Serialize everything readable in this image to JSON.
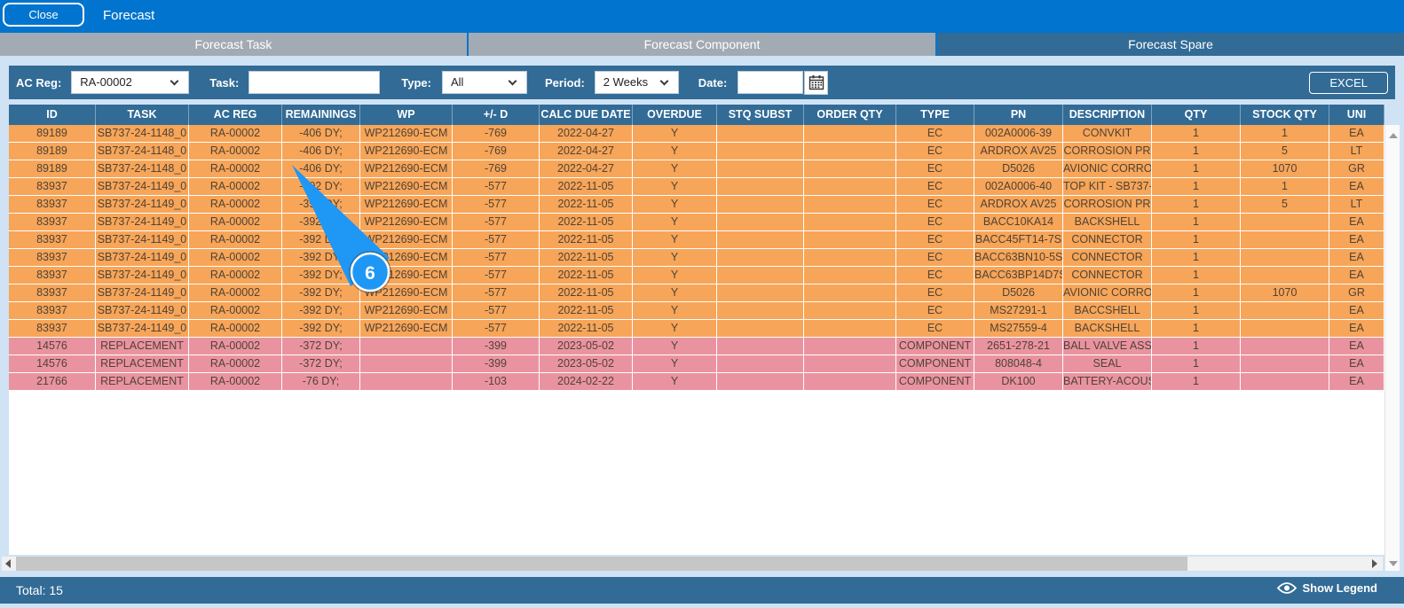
{
  "header": {
    "title": "Forecast",
    "close_label": "Close"
  },
  "tabs": [
    {
      "label": "Forecast Task",
      "active": false
    },
    {
      "label": "Forecast Component",
      "active": false
    },
    {
      "label": "Forecast Spare",
      "active": true
    }
  ],
  "filters": {
    "ac_reg_label": "AC Reg:",
    "ac_reg_value": "RA-00002",
    "task_label": "Task:",
    "task_value": "",
    "type_label": "Type:",
    "type_value": "All",
    "period_label": "Period:",
    "period_value": "2 Weeks",
    "date_label": "Date:",
    "date_value": "",
    "excel_label": "EXCEL",
    "calendar_icon": "calendar-icon"
  },
  "table": {
    "columns": [
      {
        "label": "ID"
      },
      {
        "label": "TASK"
      },
      {
        "label": "AC REG"
      },
      {
        "label": "REMAININGS"
      },
      {
        "label": "WP"
      },
      {
        "label": "+/- D"
      },
      {
        "label": "CALC DUE DATE"
      },
      {
        "label": "OVERDUE"
      },
      {
        "label": "STQ SUBST"
      },
      {
        "label": "ORDER QTY"
      },
      {
        "label": "TYPE"
      },
      {
        "label": "PN"
      },
      {
        "label": "DESCRIPTION"
      },
      {
        "label": "QTY"
      },
      {
        "label": "STOCK QTY"
      },
      {
        "label": "UNI"
      }
    ],
    "rows": [
      {
        "tone": "orange",
        "cells": [
          "89189",
          "SB737-24-1148_0",
          "RA-00002",
          "-406 DY;",
          "WP212690-ECM",
          "-769",
          "2022-04-27",
          "Y",
          "",
          "",
          "EC",
          "002A0006-39",
          "CONVKIT",
          "1",
          "1",
          "EA"
        ]
      },
      {
        "tone": "orange",
        "cells": [
          "89189",
          "SB737-24-1148_0",
          "RA-00002",
          "-406 DY;",
          "WP212690-ECM",
          "-769",
          "2022-04-27",
          "Y",
          "",
          "",
          "EC",
          "ARDROX AV25",
          "CORROSION PR",
          "1",
          "5",
          "LT"
        ]
      },
      {
        "tone": "orange",
        "cells": [
          "89189",
          "SB737-24-1148_0",
          "RA-00002",
          "-406 DY;",
          "WP212690-ECM",
          "-769",
          "2022-04-27",
          "Y",
          "",
          "",
          "EC",
          "D5026",
          "AVIONIC CORRO",
          "1",
          "1070",
          "GR"
        ]
      },
      {
        "tone": "orange",
        "cells": [
          "83937",
          "SB737-24-1149_0",
          "RA-00002",
          "-392 DY;",
          "WP212690-ECM",
          "-577",
          "2022-11-05",
          "Y",
          "",
          "",
          "EC",
          "002A0006-40",
          "TOP KIT - SB737-",
          "1",
          "1",
          "EA"
        ]
      },
      {
        "tone": "orange",
        "cells": [
          "83937",
          "SB737-24-1149_0",
          "RA-00002",
          "-392 DY;",
          "WP212690-ECM",
          "-577",
          "2022-11-05",
          "Y",
          "",
          "",
          "EC",
          "ARDROX AV25",
          "CORROSION PR",
          "1",
          "5",
          "LT"
        ]
      },
      {
        "tone": "orange",
        "cells": [
          "83937",
          "SB737-24-1149_0",
          "RA-00002",
          "-392 DY;",
          "WP212690-ECM",
          "-577",
          "2022-11-05",
          "Y",
          "",
          "",
          "EC",
          "BACC10KA14",
          "BACKSHELL",
          "1",
          "",
          "EA"
        ]
      },
      {
        "tone": "orange",
        "cells": [
          "83937",
          "SB737-24-1149_0",
          "RA-00002",
          "-392 DY;",
          "WP212690-ECM",
          "-577",
          "2022-11-05",
          "Y",
          "",
          "",
          "EC",
          "BACC45FT14-7S",
          "CONNECTOR",
          "1",
          "",
          "EA"
        ]
      },
      {
        "tone": "orange",
        "cells": [
          "83937",
          "SB737-24-1149_0",
          "RA-00002",
          "-392 DY;",
          "WP212690-ECM",
          "-577",
          "2022-11-05",
          "Y",
          "",
          "",
          "EC",
          "BACC63BN10-5S",
          "CONNECTOR",
          "1",
          "",
          "EA"
        ]
      },
      {
        "tone": "orange",
        "cells": [
          "83937",
          "SB737-24-1149_0",
          "RA-00002",
          "-392 DY;",
          "WP212690-ECM",
          "-577",
          "2022-11-05",
          "Y",
          "",
          "",
          "EC",
          "BACC63BP14D7S",
          "CONNECTOR",
          "1",
          "",
          "EA"
        ]
      },
      {
        "tone": "orange",
        "cells": [
          "83937",
          "SB737-24-1149_0",
          "RA-00002",
          "-392 DY;",
          "WP212690-ECM",
          "-577",
          "2022-11-05",
          "Y",
          "",
          "",
          "EC",
          "D5026",
          "AVIONIC CORRO",
          "1",
          "1070",
          "GR"
        ]
      },
      {
        "tone": "orange",
        "cells": [
          "83937",
          "SB737-24-1149_0",
          "RA-00002",
          "-392 DY;",
          "WP212690-ECM",
          "-577",
          "2022-11-05",
          "Y",
          "",
          "",
          "EC",
          "MS27291-1",
          "BACCSHELL",
          "1",
          "",
          "EA"
        ]
      },
      {
        "tone": "orange",
        "cells": [
          "83937",
          "SB737-24-1149_0",
          "RA-00002",
          "-392 DY;",
          "WP212690-ECM",
          "-577",
          "2022-11-05",
          "Y",
          "",
          "",
          "EC",
          "MS27559-4",
          "BACKSHELL",
          "1",
          "",
          "EA"
        ]
      },
      {
        "tone": "pink",
        "cells": [
          "14576",
          "REPLACEMENT",
          "RA-00002",
          "-372 DY;",
          "",
          "-399",
          "2023-05-02",
          "Y",
          "",
          "",
          "COMPONENT",
          "2651-278-21",
          "BALL VALVE ASS",
          "1",
          "",
          "EA"
        ]
      },
      {
        "tone": "pink",
        "cells": [
          "14576",
          "REPLACEMENT",
          "RA-00002",
          "-372 DY;",
          "",
          "-399",
          "2023-05-02",
          "Y",
          "",
          "",
          "COMPONENT",
          "808048-4",
          "SEAL",
          "1",
          "",
          "EA"
        ]
      },
      {
        "tone": "pink",
        "cells": [
          "21766",
          "REPLACEMENT",
          "RA-00002",
          "-76 DY;",
          "",
          "-103",
          "2024-02-22",
          "Y",
          "",
          "",
          "COMPONENT",
          "DK100",
          "BATTERY-ACOUS",
          "1",
          "",
          "EA"
        ]
      }
    ]
  },
  "footer": {
    "total_label": "Total: 15",
    "show_legend_label": "Show Legend",
    "eye_icon": "eye-icon"
  },
  "annotation": {
    "badge": "6"
  },
  "colors": {
    "topbar_blue": "#0074ce",
    "panel_blue": "#326b96",
    "tab_inactive_gray": "#a2abb3",
    "row_orange": "#f7a558",
    "row_pink": "#ea93a0",
    "annotation_blue": "#1e97f5"
  }
}
